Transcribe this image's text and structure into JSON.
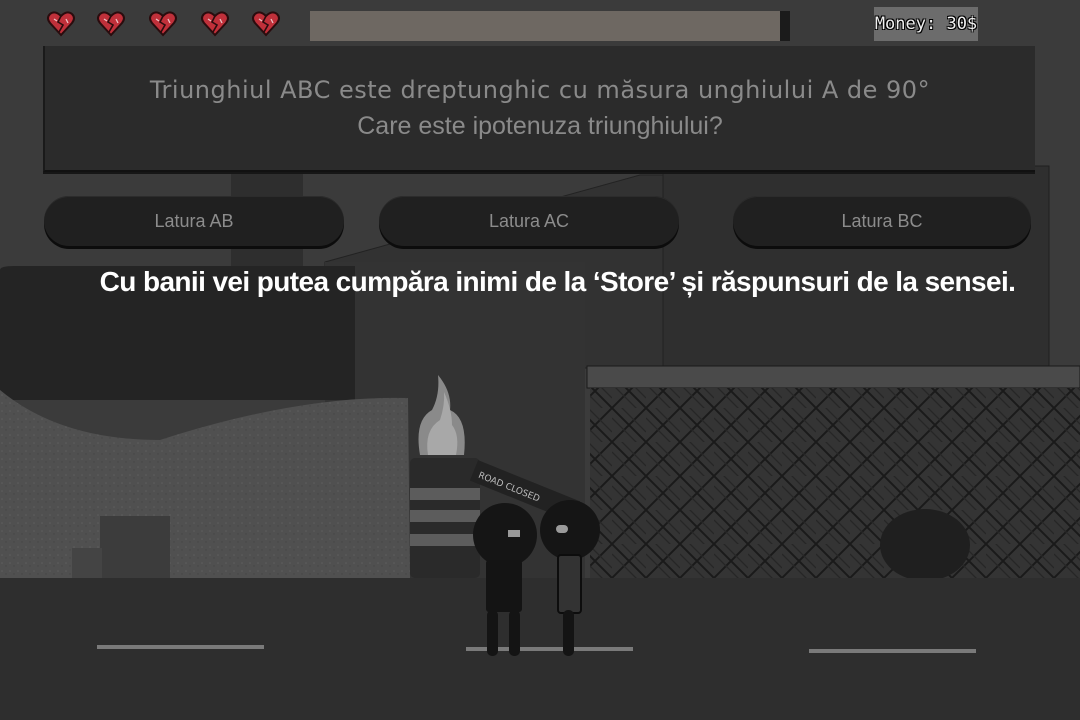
{
  "hud": {
    "hearts_count": 5,
    "heart_icon": "broken-heart-icon",
    "heart_color": "#c0303a",
    "timer_remaining_fraction": 0.98,
    "money_text": "Money: 30$"
  },
  "question": {
    "line1": "Triunghiul ABC este dreptunghic cu măsura unghiului A de 90°",
    "line2": "Care este ipotenuza triunghiului?"
  },
  "answers": [
    {
      "label": "Latura AB"
    },
    {
      "label": "Latura AC"
    },
    {
      "label": "Latura BC"
    }
  ],
  "hint": "Cu banii vei putea cumpăra inimi de la ‘Store’ și răspunsuri de la sensei.",
  "scene": {
    "sign_text": "ROAD CLOSED"
  }
}
